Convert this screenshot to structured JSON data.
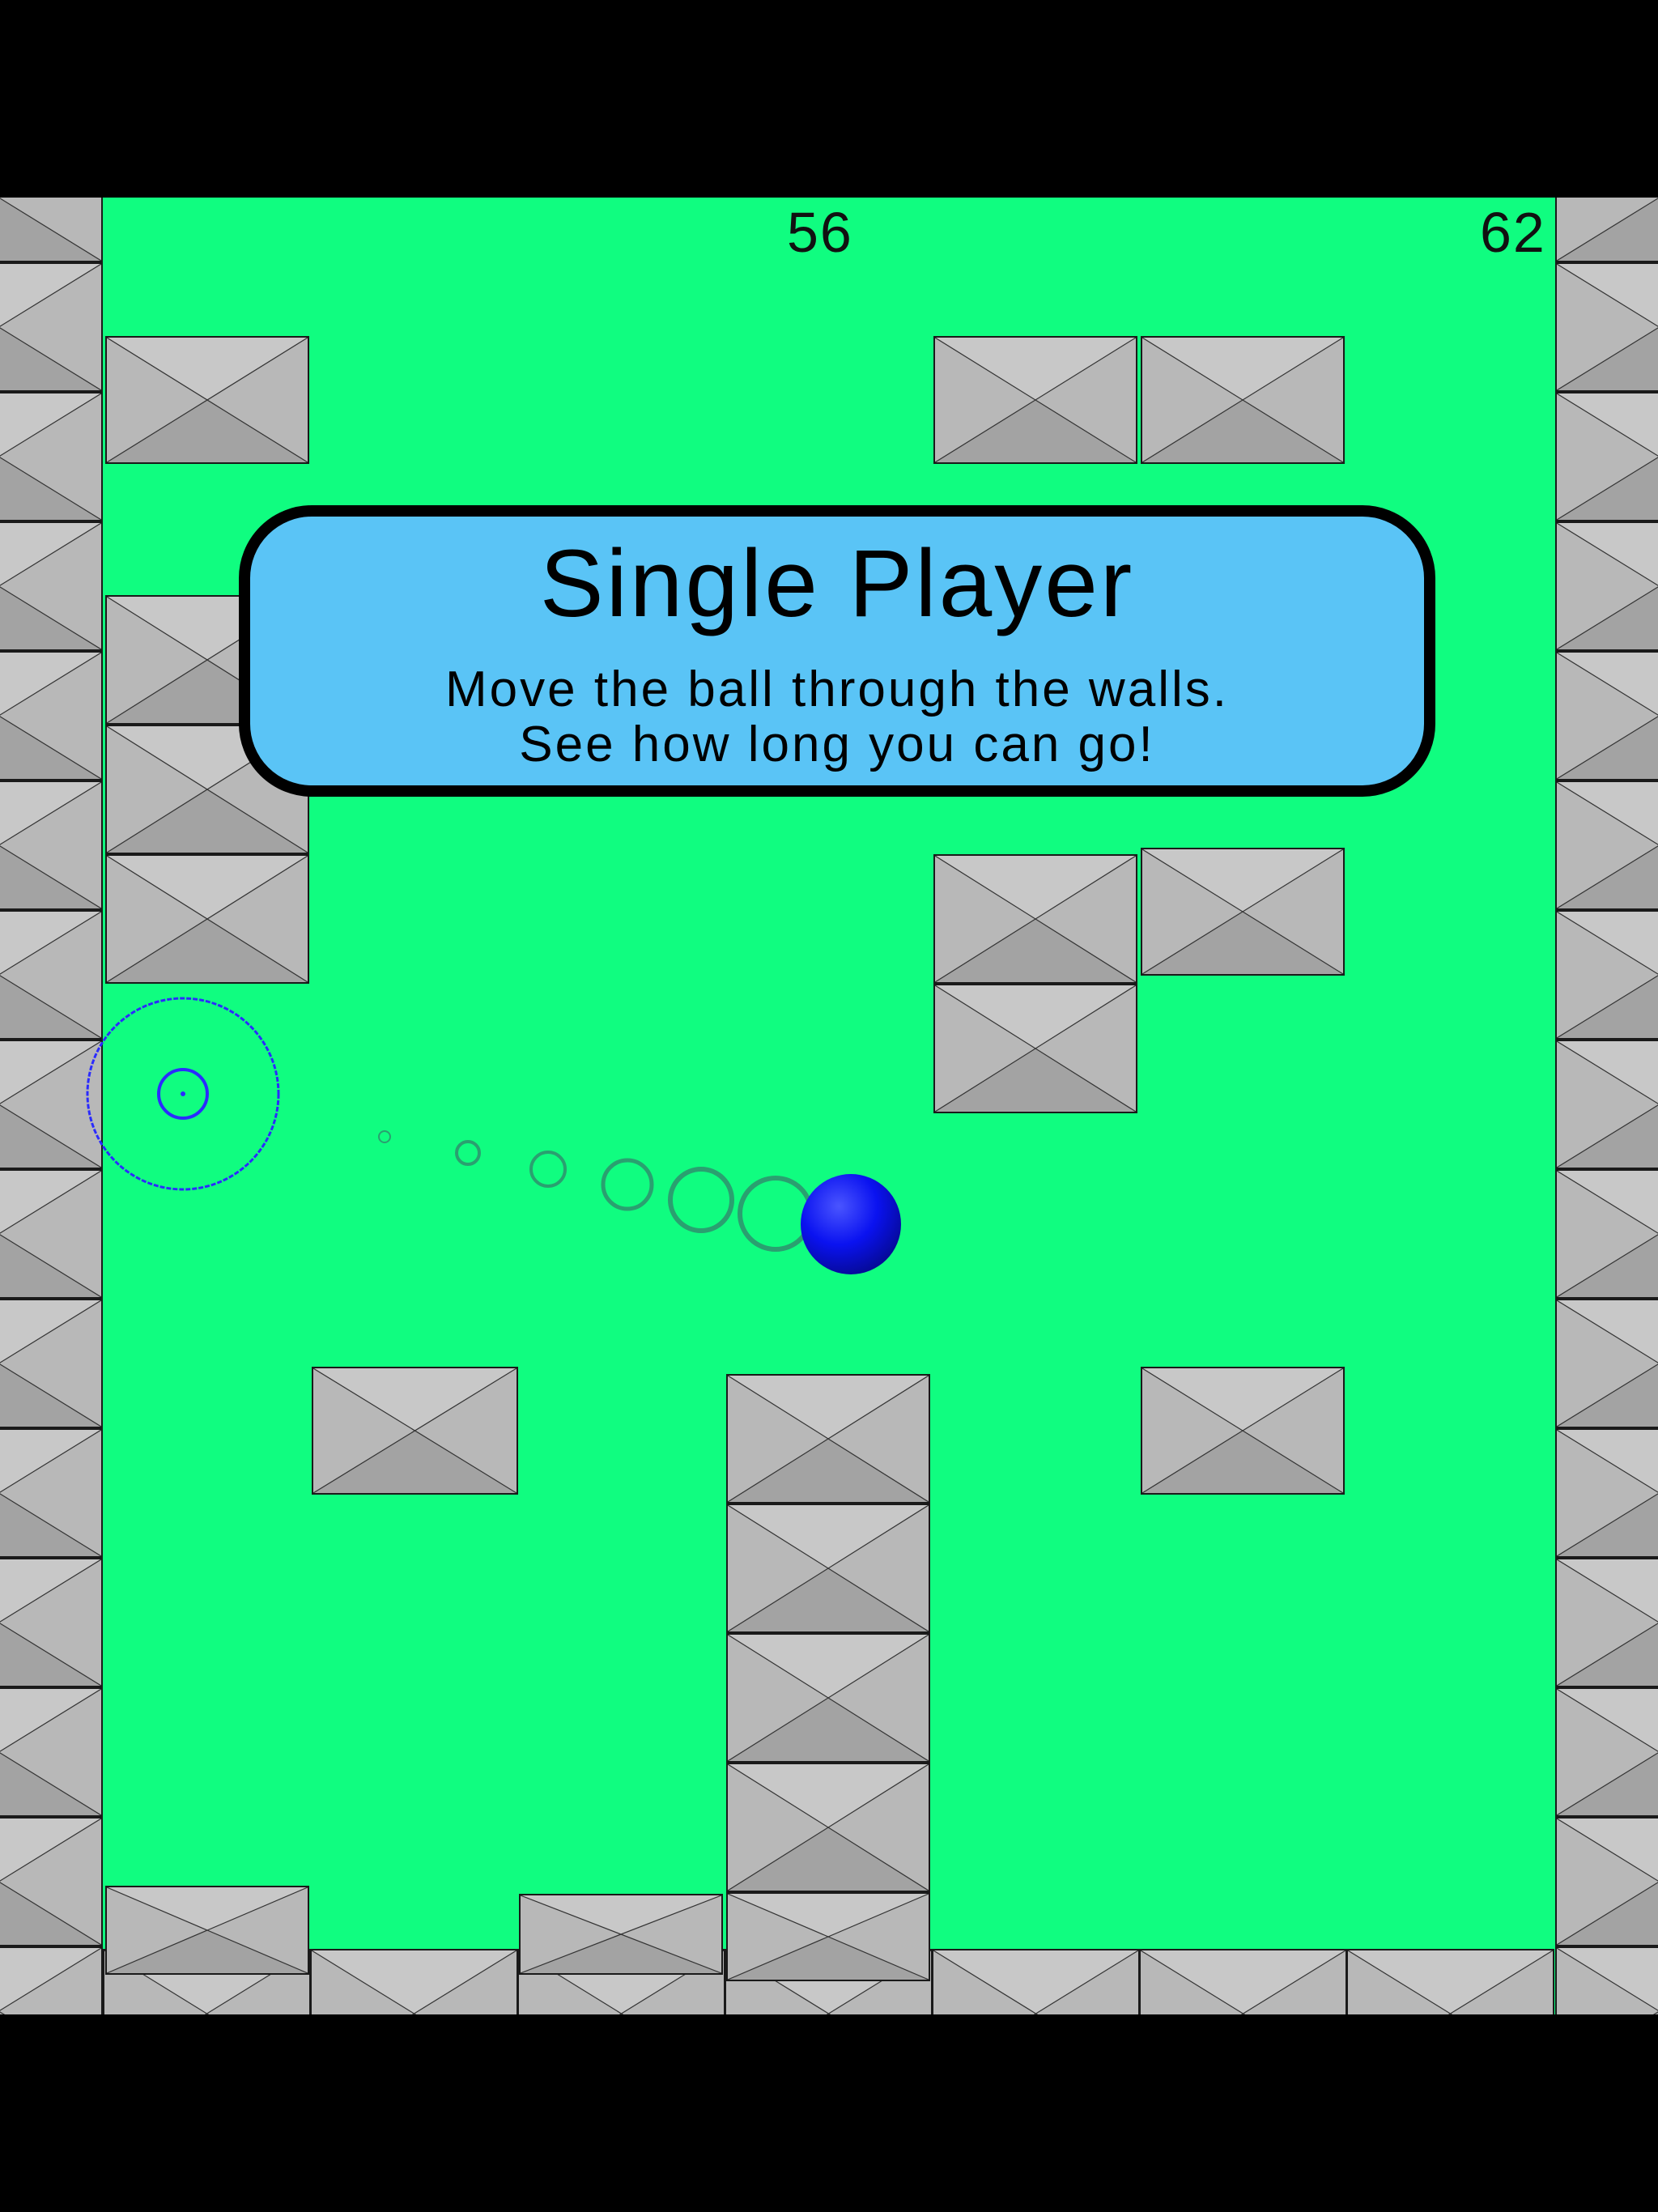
{
  "game": {
    "scores": {
      "current": "56",
      "best": "62"
    },
    "info_card": {
      "title": "Single Player",
      "line1": "Move the ball through the walls.",
      "line2": "See how long you can go!"
    }
  },
  "colors": {
    "background": "#000000",
    "playfield": "#10fd80",
    "card_fill": "#5ac4f6",
    "card_border": "#000000",
    "block_light": "#c8c8c8",
    "block_side": "#b8b8b8",
    "block_dark": "#a3a3a3",
    "ball": "#0a12f0",
    "trail": "#2aa070",
    "target_ring": "#2b2bff"
  },
  "icons": {
    "player": "blue-ball",
    "target": "concentric-ring-target",
    "wall": "x-crossed-grey-block"
  }
}
